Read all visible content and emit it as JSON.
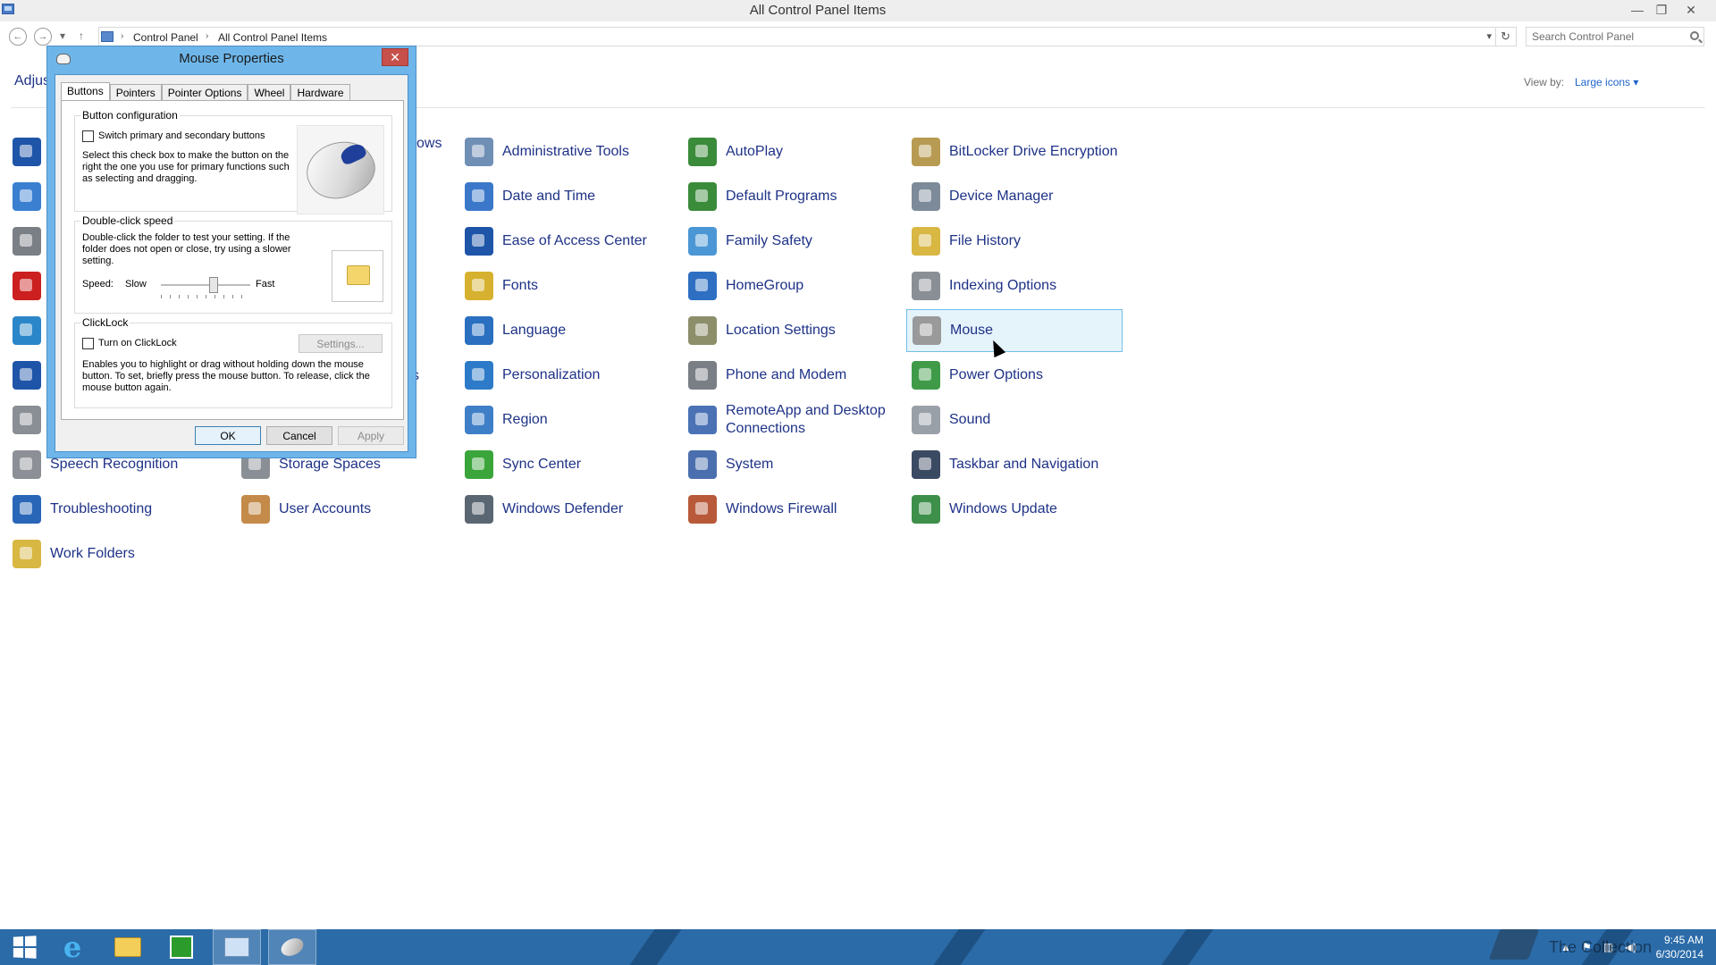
{
  "window": {
    "title": "All Control Panel Items",
    "minimize": "—",
    "restore": "❐",
    "close": "✕"
  },
  "address": {
    "back": "←",
    "forward": "→",
    "up": "↑",
    "crumbs": [
      "Control Panel",
      "All Control Panel Items"
    ],
    "separator": "›",
    "refresh": "↻",
    "search_placeholder": "Search Control Panel"
  },
  "header": {
    "adjust_text": "Adjust your computer's settings",
    "view_by_label": "View by:",
    "view_by_value": "Large icons ▾"
  },
  "partial_text": {
    "windows_suffix": "ows",
    "s_suffix": "s"
  },
  "items": [
    {
      "label": "Administrative Tools",
      "color": "#6f8fb5"
    },
    {
      "label": "AutoPlay",
      "color": "#3a8b3a"
    },
    {
      "label": "BitLocker Drive Encryption",
      "color": "#b89b52"
    },
    {
      "label": "Date and Time",
      "color": "#3b78c9"
    },
    {
      "label": "Default Programs",
      "color": "#3a8b3a"
    },
    {
      "label": "Device Manager",
      "color": "#7d8a99"
    },
    {
      "label": "Ease of Access Center",
      "color": "#1f55a8"
    },
    {
      "label": "Family Safety",
      "color": "#4b97d5"
    },
    {
      "label": "File History",
      "color": "#d8b742"
    },
    {
      "label": "Fonts",
      "color": "#d6b12f"
    },
    {
      "label": "HomeGroup",
      "color": "#2f6fc2"
    },
    {
      "label": "Indexing Options",
      "color": "#8a8f96"
    },
    {
      "label": "Language",
      "color": "#2a6fc0"
    },
    {
      "label": "Location Settings",
      "color": "#8c8f6a"
    },
    {
      "label": "Mouse",
      "color": "#9a9a9a"
    },
    {
      "label": "Personalization",
      "color": "#2d7bc8"
    },
    {
      "label": "Phone and Modem",
      "color": "#7a7f86"
    },
    {
      "label": "Power Options",
      "color": "#3f9b48"
    },
    {
      "label": "Region",
      "color": "#3f7fc7"
    },
    {
      "label": "RemoteApp and Desktop Connections",
      "color": "#4a72b5"
    },
    {
      "label": "Sound",
      "color": "#9aa0a8"
    },
    {
      "label": "Sync Center",
      "color": "#3aa53a"
    },
    {
      "label": "System",
      "color": "#4b6fae"
    },
    {
      "label": "Taskbar and Navigation",
      "color": "#3b4a63"
    },
    {
      "label": "Windows Defender",
      "color": "#5b6673"
    },
    {
      "label": "Windows Firewall",
      "color": "#b85a3a"
    },
    {
      "label": "Windows Update",
      "color": "#3d8f4a"
    },
    {
      "label": "Speech Recognition",
      "color": "#8c8f96"
    },
    {
      "label": "Storage Spaces",
      "color": "#8a8f96"
    },
    {
      "label": "Troubleshooting",
      "color": "#2a66b8"
    },
    {
      "label": "User Accounts",
      "color": "#c48a4a"
    },
    {
      "label": "Work Folders",
      "color": "#d8b742"
    }
  ],
  "left_icon_colors": [
    "#1f55a8",
    "#3a7fd0",
    "#7a7f86",
    "#cc1f1f",
    "#2b86c9",
    "#1f55a8",
    "#8a8f96"
  ],
  "dialog": {
    "title": "Mouse Properties",
    "close": "✕",
    "tabs": [
      "Buttons",
      "Pointers",
      "Pointer Options",
      "Wheel",
      "Hardware"
    ],
    "button_config": {
      "title": "Button configuration",
      "checkbox_label": "Switch primary and secondary buttons",
      "description": "Select this check box to make the button on the right the one you use for primary functions such as selecting and dragging."
    },
    "double_click": {
      "title": "Double-click speed",
      "description": "Double-click the folder to test your setting. If the folder does not open or close, try using a slower setting.",
      "speed_label": "Speed:",
      "slow": "Slow",
      "fast": "Fast",
      "speed_value": 0.6
    },
    "clicklock": {
      "title": "ClickLock",
      "checkbox_label": "Turn on ClickLock",
      "settings_button": "Settings...",
      "description": "Enables you to highlight or drag without holding down the mouse button. To set, briefly press the mouse button. To release, click the mouse button again."
    },
    "buttons": {
      "ok": "OK",
      "cancel": "Cancel",
      "apply": "Apply"
    }
  },
  "taskbar": {
    "watermark": "The Collection",
    "time": "9:45 AM",
    "date": "6/30/2014",
    "tray_up": "▲"
  }
}
